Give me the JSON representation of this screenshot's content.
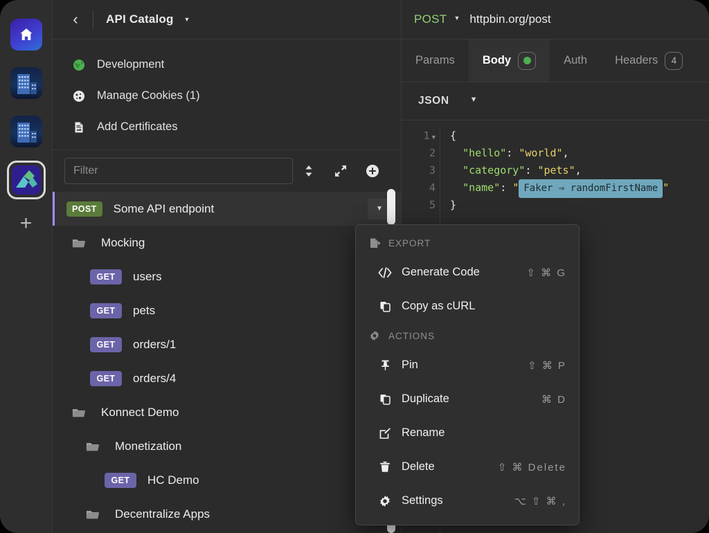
{
  "rail": {
    "workspaces": [
      {
        "name": "home-workspace",
        "icon": "home-icon",
        "active": false
      },
      {
        "name": "city-workspace-1",
        "icon": "city-icon",
        "active": false
      },
      {
        "name": "city-workspace-2",
        "icon": "city-icon",
        "active": false
      },
      {
        "name": "kong-workspace",
        "icon": "kong-logo-icon",
        "active": true
      }
    ],
    "add_label": "+"
  },
  "sidebar": {
    "back_label": "‹",
    "title": "API Catalog",
    "links": [
      {
        "label": "Development",
        "icon": "globe-icon"
      },
      {
        "label": "Manage Cookies (1)",
        "icon": "cookie-icon"
      },
      {
        "label": "Add Certificates",
        "icon": "certificate-icon"
      }
    ],
    "filter": {
      "placeholder": "Filter",
      "value": ""
    },
    "toolbar": [
      {
        "label": "sort",
        "icon": "sort-icon"
      },
      {
        "label": "expand all",
        "icon": "expand-icon"
      },
      {
        "label": "create",
        "icon": "plus-circle-icon"
      }
    ],
    "tree": [
      {
        "type": "request",
        "method": "POST",
        "label": "Some API endpoint",
        "indent": 0,
        "selected": true,
        "has_caret": true
      },
      {
        "type": "folder",
        "label": "Mocking",
        "indent": 0
      },
      {
        "type": "request",
        "method": "GET",
        "label": "users",
        "indent": 1
      },
      {
        "type": "request",
        "method": "GET",
        "label": "pets",
        "indent": 1
      },
      {
        "type": "request",
        "method": "GET",
        "label": "orders/1",
        "indent": 1
      },
      {
        "type": "request",
        "method": "GET",
        "label": "orders/4",
        "indent": 1
      },
      {
        "type": "folder",
        "label": "Konnect Demo",
        "indent": 0
      },
      {
        "type": "folder",
        "label": "Monetization",
        "indent": 1
      },
      {
        "type": "request",
        "method": "GET",
        "label": "HC Demo",
        "indent": 2
      },
      {
        "type": "folder",
        "label": "Decentralize Apps",
        "indent": 1
      }
    ]
  },
  "request": {
    "method": "POST",
    "url": "httpbin.org/post",
    "tabs": [
      {
        "label": "Params",
        "active": false,
        "badge": null,
        "dot": false
      },
      {
        "label": "Body",
        "active": true,
        "badge": null,
        "dot": true
      },
      {
        "label": "Auth",
        "active": false,
        "badge": null,
        "dot": false
      },
      {
        "label": "Headers",
        "active": false,
        "badge": "4",
        "dot": false
      }
    ],
    "body_format": "JSON",
    "editor": {
      "lines": [
        "1",
        "2",
        "3",
        "4",
        "5"
      ],
      "line1": "{",
      "line2_key": "\"hello\"",
      "line2_val": "\"world\"",
      "line3_key": "\"category\"",
      "line3_val": "\"pets\"",
      "line4_key": "\"name\"",
      "line4_tag": "Faker ⇒ randomFirstName",
      "line5": "}"
    }
  },
  "context_menu": {
    "groups": [
      {
        "label": "EXPORT",
        "icon": "export-icon"
      },
      {
        "label": "ACTIONS",
        "icon": "gear-icon"
      }
    ],
    "items": [
      {
        "label": "Generate Code",
        "shortcut": "⇧ ⌘ G",
        "icon": "code-icon",
        "group": "EXPORT"
      },
      {
        "label": "Copy as cURL",
        "shortcut": "",
        "icon": "copy-icon",
        "group": "EXPORT"
      },
      {
        "label": "Pin",
        "shortcut": "⇧ ⌘ P",
        "icon": "pin-icon",
        "group": "ACTIONS"
      },
      {
        "label": "Duplicate",
        "shortcut": "⌘ D",
        "icon": "duplicate-icon",
        "group": "ACTIONS"
      },
      {
        "label": "Rename",
        "shortcut": "",
        "icon": "pencil-icon",
        "group": "ACTIONS"
      },
      {
        "label": "Delete",
        "shortcut": "⇧ ⌘ Delete",
        "icon": "trash-icon",
        "group": "ACTIONS"
      },
      {
        "label": "Settings",
        "shortcut": "⌥ ⇧ ⌘ ,",
        "icon": "gear-icon",
        "group": "ACTIONS"
      }
    ]
  },
  "colors": {
    "accent_purple": "#a78bfa",
    "method_post": "#5b7c3a",
    "method_get": "#6b64a8",
    "status_dot": "#4caf50",
    "tag_chip": "#6fa8bd",
    "bg": "#2b2b2b"
  }
}
